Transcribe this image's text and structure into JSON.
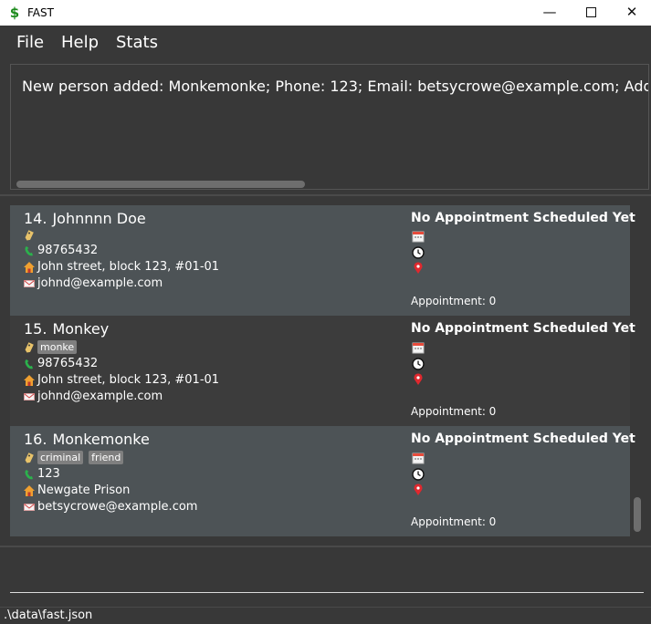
{
  "window": {
    "title": "FAST",
    "app_icon_glyph": "$",
    "minimize_glyph": "—",
    "close_glyph": "✕"
  },
  "menu": [
    "File",
    "Help",
    "Stats"
  ],
  "result_display": {
    "text": "New person added: Monkemonke; Phone: 123; Email: betsycrowe@example.com; Address: Newgate Prison; Tags: [criminal][friend]"
  },
  "persons": [
    {
      "index": "14.",
      "name": "Johnnnn Doe",
      "tags": [],
      "phone": "98765432",
      "address": "John street, block 123, #01-01",
      "email": "johnd@example.com",
      "appointment_title": "No Appointment Scheduled Yet",
      "appointment_count": "Appointment: 0"
    },
    {
      "index": "15.",
      "name": "Monkey",
      "tags": [
        "monke"
      ],
      "phone": "98765432",
      "address": "John street, block 123, #01-01",
      "email": "johnd@example.com",
      "appointment_title": "No Appointment Scheduled Yet",
      "appointment_count": "Appointment: 0"
    },
    {
      "index": "16.",
      "name": "Monkemonke",
      "tags": [
        "criminal",
        "friend"
      ],
      "phone": "123",
      "address": "Newgate Prison",
      "email": "betsycrowe@example.com",
      "appointment_title": "No Appointment Scheduled Yet",
      "appointment_count": "Appointment: 0"
    }
  ],
  "command_box": {
    "value": ""
  },
  "status_bar": {
    "path": ".\\data\\fast.json"
  },
  "icons": [
    "tag-icon",
    "phone-icon",
    "house-icon",
    "envelope-icon",
    "calendar-icon",
    "clock-icon",
    "location-pin-icon"
  ],
  "colors": {
    "background": "#383838",
    "card_light": "#4d5356",
    "card_dark": "#3c3c3c",
    "tag_bg": "#7f7f7f",
    "dollar_green": "#1b8a1b"
  }
}
